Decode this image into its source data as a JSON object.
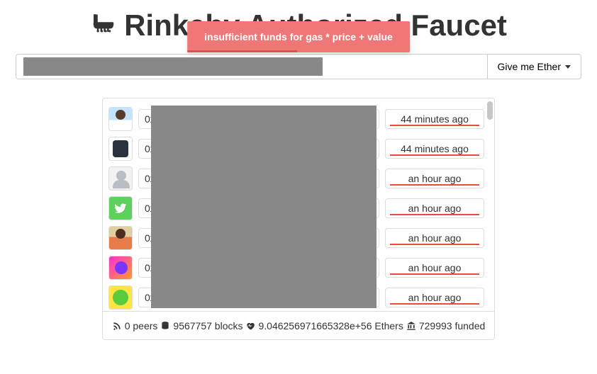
{
  "header": {
    "title": "Rinkeby Authorized Faucet"
  },
  "alert": {
    "message": "insufficient funds for gas * price + value"
  },
  "request": {
    "button_label": "Give me Ether"
  },
  "queue": [
    {
      "avatar": "av-person",
      "addr": "0x",
      "time": "44 minutes ago"
    },
    {
      "avatar": "av-jacket",
      "addr": "0x",
      "time": "44 minutes ago"
    },
    {
      "avatar": "av-blank",
      "addr": "0x",
      "time": "an hour ago"
    },
    {
      "avatar": "av-twitter",
      "addr": "0x",
      "time": "an hour ago"
    },
    {
      "avatar": "av-photo",
      "addr": "0x",
      "time": "an hour ago"
    },
    {
      "avatar": "av-pink",
      "addr": "0x",
      "time": "an hour ago"
    },
    {
      "avatar": "av-green",
      "addr": "0x",
      "time": "an hour ago"
    }
  ],
  "stats": {
    "peers": "0 peers",
    "blocks": "9567757 blocks",
    "ethers": "9.046256971665328e+56 Ethers",
    "funded": "729993 funded"
  }
}
